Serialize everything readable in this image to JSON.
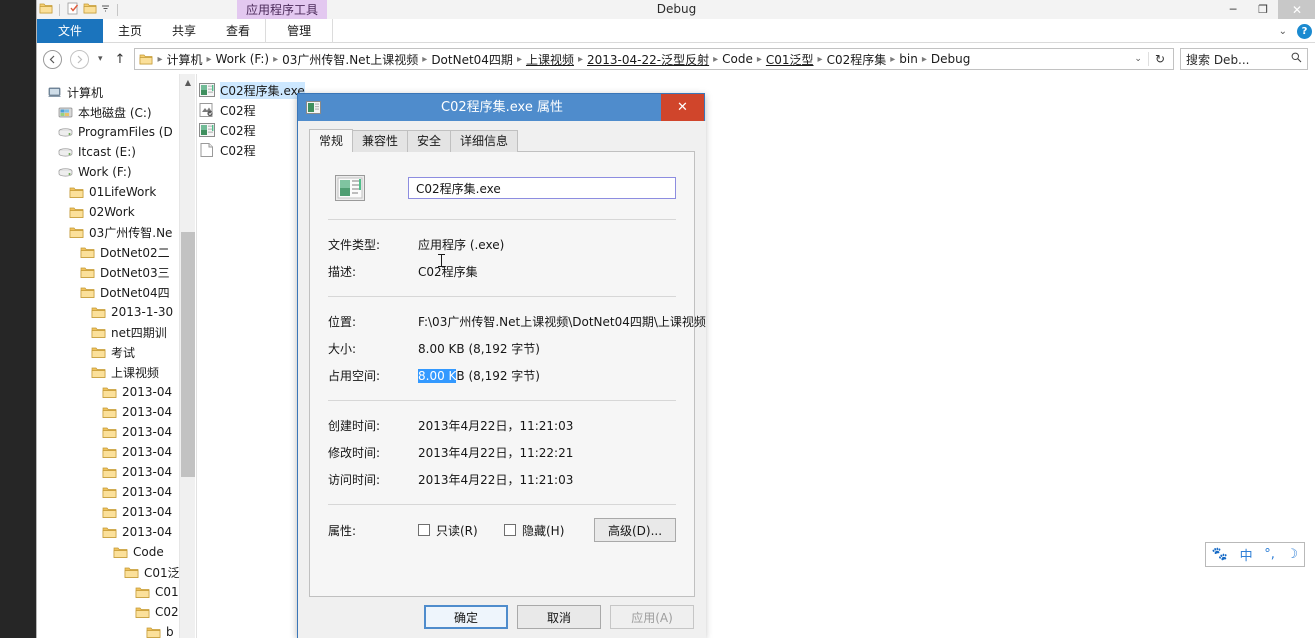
{
  "window": {
    "title": "Debug",
    "minimize": "─",
    "restore": "❐",
    "close": "✕"
  },
  "quick_access": {
    "items": [
      "folder-icon",
      "properties-icon",
      "new-folder-icon",
      "customize-dropdown-icon"
    ]
  },
  "ribbon": {
    "contextual_tab": "应用程序工具",
    "tabs": [
      {
        "label": "文件",
        "active": true
      },
      {
        "label": "主页",
        "active": false
      },
      {
        "label": "共享",
        "active": false
      },
      {
        "label": "查看",
        "active": false
      },
      {
        "label": "管理",
        "active": false,
        "contextual": true
      }
    ],
    "collapse_glyph": "⌄",
    "help_glyph": "?"
  },
  "addressbar": {
    "back_glyph": "←",
    "forward_glyph": "→",
    "recent_glyph": "▾",
    "up_glyph": "↑",
    "crumbs": [
      "计算机",
      "Work (F:)",
      "03广州传智.Net上课视频",
      "DotNet04四期",
      "上课视频",
      "2013-04-22-泛型反射",
      "Code",
      "C01泛型",
      "C02程序集",
      "bin",
      "Debug"
    ],
    "separator": "▸",
    "dropdown_glyph": "⌄",
    "refresh_glyph": "↻",
    "search_placeholder": "搜索 Deb...",
    "search_glyph": "⚲"
  },
  "navpane": {
    "items": [
      {
        "label": "计算机",
        "indent": 0,
        "icon": "computer-icon"
      },
      {
        "label": "本地磁盘 (C:)",
        "indent": 1,
        "icon": "system-drive-icon"
      },
      {
        "label": "ProgramFiles (D",
        "indent": 1,
        "icon": "drive-icon"
      },
      {
        "label": "Itcast (E:)",
        "indent": 1,
        "icon": "drive-icon"
      },
      {
        "label": "Work (F:)",
        "indent": 1,
        "icon": "drive-icon"
      },
      {
        "label": "01LifeWork",
        "indent": 2,
        "icon": "folder-icon"
      },
      {
        "label": "02Work",
        "indent": 2,
        "icon": "folder-icon"
      },
      {
        "label": "03广州传智.Ne",
        "indent": 2,
        "icon": "folder-icon"
      },
      {
        "label": "DotNet02二",
        "indent": 3,
        "icon": "folder-icon"
      },
      {
        "label": "DotNet03三",
        "indent": 3,
        "icon": "folder-icon"
      },
      {
        "label": "DotNet04四",
        "indent": 3,
        "icon": "folder-icon"
      },
      {
        "label": "2013-1-30",
        "indent": 4,
        "icon": "folder-icon"
      },
      {
        "label": "net四期训",
        "indent": 4,
        "icon": "folder-icon"
      },
      {
        "label": "考试",
        "indent": 4,
        "icon": "folder-icon"
      },
      {
        "label": "上课视频",
        "indent": 4,
        "icon": "folder-icon"
      },
      {
        "label": "2013-04",
        "indent": 5,
        "icon": "folder-icon"
      },
      {
        "label": "2013-04",
        "indent": 5,
        "icon": "folder-icon"
      },
      {
        "label": "2013-04",
        "indent": 5,
        "icon": "folder-icon"
      },
      {
        "label": "2013-04",
        "indent": 5,
        "icon": "folder-icon"
      },
      {
        "label": "2013-04",
        "indent": 5,
        "icon": "folder-icon"
      },
      {
        "label": "2013-04",
        "indent": 5,
        "icon": "folder-icon"
      },
      {
        "label": "2013-04",
        "indent": 5,
        "icon": "folder-icon"
      },
      {
        "label": "2013-04",
        "indent": 5,
        "icon": "folder-icon"
      },
      {
        "label": "Code",
        "indent": 6,
        "icon": "folder-icon"
      },
      {
        "label": "C01泛",
        "indent": 7,
        "icon": "folder-icon"
      },
      {
        "label": "C01",
        "indent": 8,
        "icon": "folder-icon"
      },
      {
        "label": "C02",
        "indent": 8,
        "icon": "folder-icon"
      },
      {
        "label": "b",
        "indent": 9,
        "icon": "folder-icon"
      }
    ],
    "scroll_up_glyph": "▲"
  },
  "filelist": {
    "items": [
      {
        "label": "C02程序集.exe",
        "icon": "exe-icon",
        "selected": true
      },
      {
        "label": "C02程",
        "icon": "pdb-icon",
        "selected": false
      },
      {
        "label": "C02程",
        "icon": "exe-icon",
        "selected": false
      },
      {
        "label": "C02程",
        "icon": "document-icon",
        "selected": false
      }
    ]
  },
  "dialog": {
    "title": "C02程序集.exe 属性",
    "close_glyph": "✕",
    "tabs": [
      {
        "label": "常规",
        "active": true
      },
      {
        "label": "兼容性",
        "active": false
      },
      {
        "label": "安全",
        "active": false
      },
      {
        "label": "详细信息",
        "active": false
      }
    ],
    "filename": "C02程序集.exe",
    "fields": [
      {
        "label": "文件类型:",
        "value": "应用程序 (.exe)"
      },
      {
        "label": "描述:",
        "value": "C02程序集"
      }
    ],
    "fields2": [
      {
        "label": "位置:",
        "value": "F:\\03广州传智.Net上课视频\\DotNet04四期\\上课视频"
      },
      {
        "label": "大小:",
        "value": "8.00 KB (8,192 字节)"
      }
    ],
    "size_on_disk": {
      "label": "占用空间:",
      "selected_text": "8.00 K",
      "rest_text": "B (8,192 字节)",
      "selection_color": "#3399ff"
    },
    "fields3": [
      {
        "label": "创建时间:",
        "value": "2013年4月22日，11:21:03"
      },
      {
        "label": "修改时间:",
        "value": "2013年4月22日，11:22:21"
      },
      {
        "label": "访问时间:",
        "value": "2013年4月22日，11:21:03"
      }
    ],
    "attributes": {
      "label": "属性:",
      "readonly": {
        "label": "只读(R)",
        "checked": false
      },
      "hidden": {
        "label": "隐藏(H)",
        "checked": false
      },
      "advanced_button": "高级(D)..."
    },
    "buttons": [
      {
        "label": "确定",
        "state": "default"
      },
      {
        "label": "取消",
        "state": "normal"
      },
      {
        "label": "应用(A)",
        "state": "disabled"
      }
    ]
  },
  "ime": {
    "items": [
      "🐾",
      "中",
      "°,",
      "☽"
    ],
    "color": "#2f7fd6"
  }
}
